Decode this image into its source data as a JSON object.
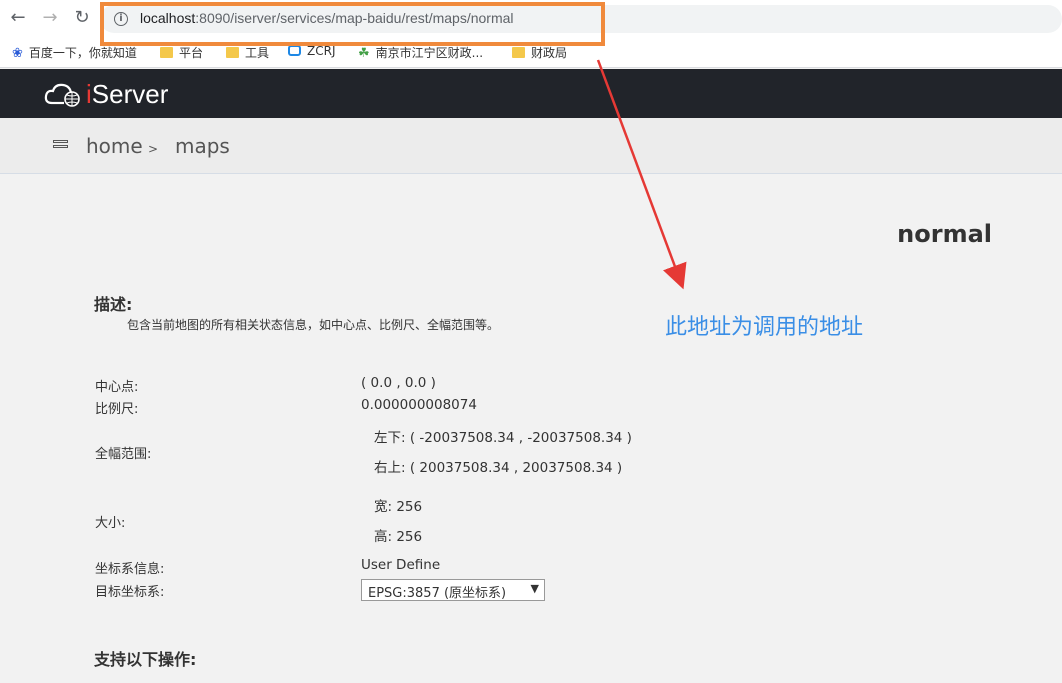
{
  "browser": {
    "back_icon": "arrow-left-icon",
    "forward_icon": "arrow-right-icon",
    "reload_icon": "reload-icon",
    "url_host": "localhost",
    "url_rest": ":8090/iserver/services/map-baidu/rest/maps/normal",
    "bookmarks": [
      {
        "label": "百度一下，你就知道"
      },
      {
        "label": "平台"
      },
      {
        "label": "工具"
      },
      {
        "label": "ZCRJ"
      },
      {
        "label": "南京市江宁区财政..."
      },
      {
        "label": "财政局"
      }
    ]
  },
  "app": {
    "logo_text": "Server",
    "logo_i": "i"
  },
  "breadcrumb": {
    "home": "home",
    "separator": ">",
    "current": "maps"
  },
  "page": {
    "title": "normal",
    "description_heading": "描述:",
    "description_text": "包含当前地图的所有相关状态信息，如中心点、比例尺、全幅范围等。",
    "annotation": "此地址为调用的地址",
    "fields": {
      "center_label": "中心点:",
      "center_value": "( 0.0 , 0.0 )",
      "scale_label": "比例尺:",
      "scale_value": "0.000000008074",
      "bounds_label": "全幅范围:",
      "bounds_lower_left": "左下:  ( -20037508.34 , -20037508.34 )",
      "bounds_upper_right": "右上:  ( 20037508.34 , 20037508.34 )",
      "size_label": "大小:",
      "width": "宽:  256",
      "height": "高:  256",
      "crs_label": "坐标系信息:",
      "crs_value": "User Define",
      "target_crs_label": "目标坐标系:",
      "target_crs_selected": "EPSG:3857  (原坐标系)"
    },
    "operations_heading": "支持以下操作:"
  },
  "colors": {
    "highlight": "#f08a3c",
    "annotation": "#3a8ee6",
    "arrow": "#e53935",
    "navbar": "#21242a"
  }
}
